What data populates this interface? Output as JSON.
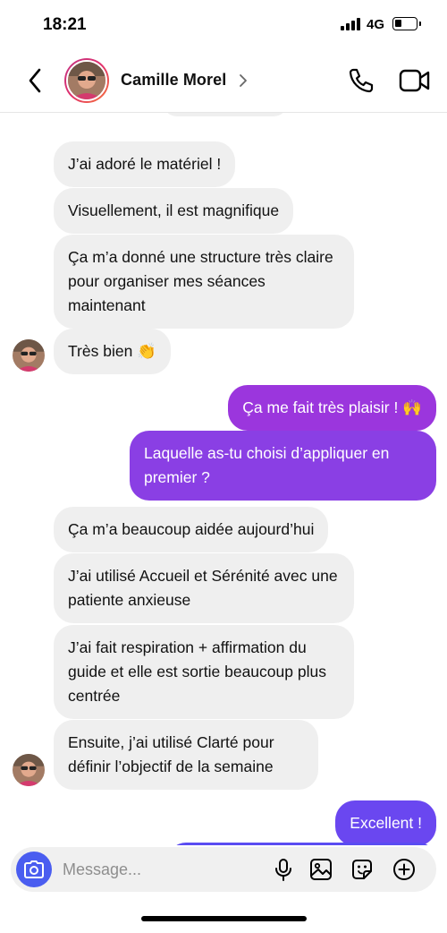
{
  "status_bar": {
    "time": "18:21",
    "network": "4G",
    "battery_level": 0.35
  },
  "header": {
    "contact_name": "Camille Morel",
    "icons": [
      "back-arrow-icon",
      "chevron-right-icon",
      "phone-icon",
      "video-camera-icon"
    ]
  },
  "messages": [
    {
      "side": "in",
      "text": "J’ai adoré le matériel !"
    },
    {
      "side": "in",
      "text": "Visuellement, il est magnifique"
    },
    {
      "side": "in",
      "text": "Ça m’a donné une structure très claire pour organiser mes séances maintenant"
    },
    {
      "side": "in",
      "text": "Très bien 👏"
    },
    {
      "side": "out",
      "text": "Ça me fait très plaisir ! 🙌"
    },
    {
      "side": "out",
      "text": "Laquelle as-tu choisi d’appliquer en premier ?"
    },
    {
      "side": "in",
      "text": "Ça m’a beaucoup aidée aujourd’hui"
    },
    {
      "side": "in",
      "text": "J’ai utilisé Accueil et Sérénité avec une patiente anxieuse"
    },
    {
      "side": "in",
      "text": "J’ai fait respiration + affirmation du guide et elle est sortie beaucoup plus centrée"
    },
    {
      "side": "in",
      "text": "Ensuite, j’ai utilisé Clarté pour définir l’objectif de la semaine"
    },
    {
      "side": "out",
      "text": "Excellent !"
    }
  ],
  "composer": {
    "placeholder": "Message...",
    "icons": [
      "camera-icon",
      "microphone-icon",
      "image-icon",
      "sticker-icon",
      "plus-icon"
    ]
  },
  "colors": {
    "incoming_bubble": "#efefef",
    "outgoing_gradient": [
      "#9b36dd",
      "#8a3fe4",
      "#6a47f0",
      "#5a4cf2"
    ],
    "camera_button": "#4a5df0"
  }
}
